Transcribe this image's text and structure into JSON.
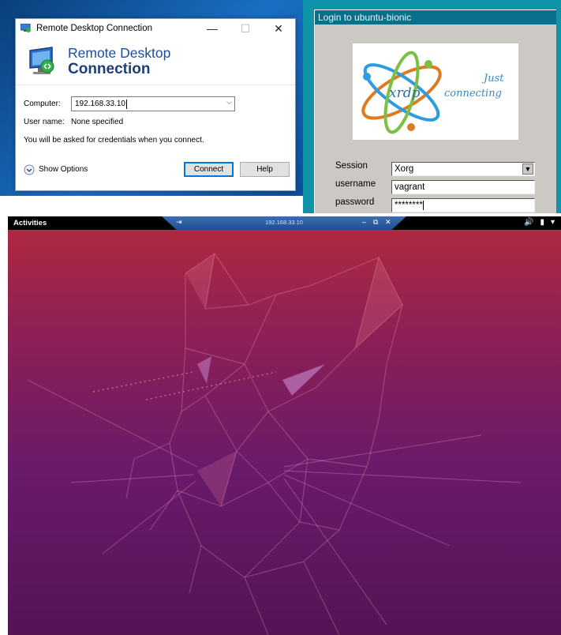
{
  "rdc": {
    "window_title": "Remote Desktop Connection",
    "title_buttons": {
      "minimize": "—",
      "maximize": "☐",
      "close": "✕"
    },
    "banner_line1": "Remote Desktop",
    "banner_line2": "Connection",
    "computer_label": "Computer:",
    "computer_value": "192.168.33.10",
    "username_label": "User name:",
    "username_value": "None specified",
    "credentials_note": "You will be asked for credentials when you connect.",
    "show_options": "Show Options",
    "connect_button": "Connect",
    "help_button": "Help",
    "icons": [
      "rdc-app-icon",
      "computer-monitor-icon",
      "chevron-down-icon",
      "expand-circle-icon"
    ]
  },
  "xrdp": {
    "title": "Login to ubuntu-bionic",
    "logo_text": "xrdp",
    "tagline_1": "Just",
    "tagline_2": "connecting",
    "session_label": "Session",
    "session_value": "Xorg",
    "username_label": "username",
    "username_value": "vagrant",
    "password_label": "password",
    "password_value": "********"
  },
  "ubuntu": {
    "activities": "Activities",
    "remote_title": "192.168.33.10",
    "remote_bar_buttons": {
      "pin": "⇥",
      "minimize": "–",
      "restore": "⧉",
      "close": "✕"
    },
    "tray_icons": {
      "volume": "🔊",
      "battery": "▮",
      "menu": "▾"
    },
    "colors": {
      "wallpaper_top": "#b22a3e",
      "wallpaper_bottom": "#541456",
      "panel": "#000000"
    }
  }
}
